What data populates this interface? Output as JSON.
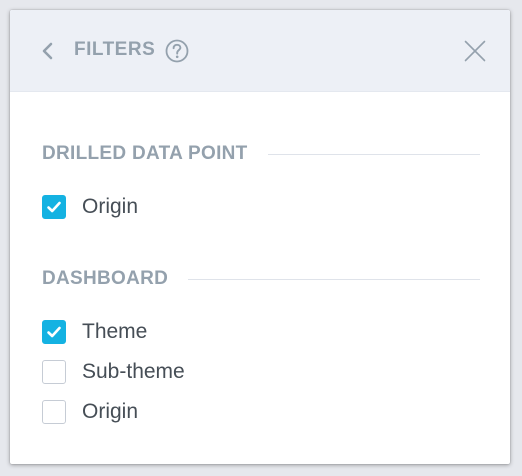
{
  "header": {
    "title": "FILTERS",
    "back_icon": "chevron-left-icon",
    "help_icon": "question-circle-icon",
    "close_icon": "close-icon"
  },
  "sections": [
    {
      "label": "DRILLED DATA POINT",
      "items": [
        {
          "label": "Origin",
          "checked": true
        }
      ]
    },
    {
      "label": "DASHBOARD",
      "items": [
        {
          "label": "Theme",
          "checked": true
        },
        {
          "label": "Sub-theme",
          "checked": false
        },
        {
          "label": "Origin",
          "checked": false
        }
      ]
    }
  ],
  "colors": {
    "accent": "#14b2e2",
    "header_bg": "#edf0f6",
    "muted_text": "#94a1ad",
    "body_text": "#464e56"
  }
}
